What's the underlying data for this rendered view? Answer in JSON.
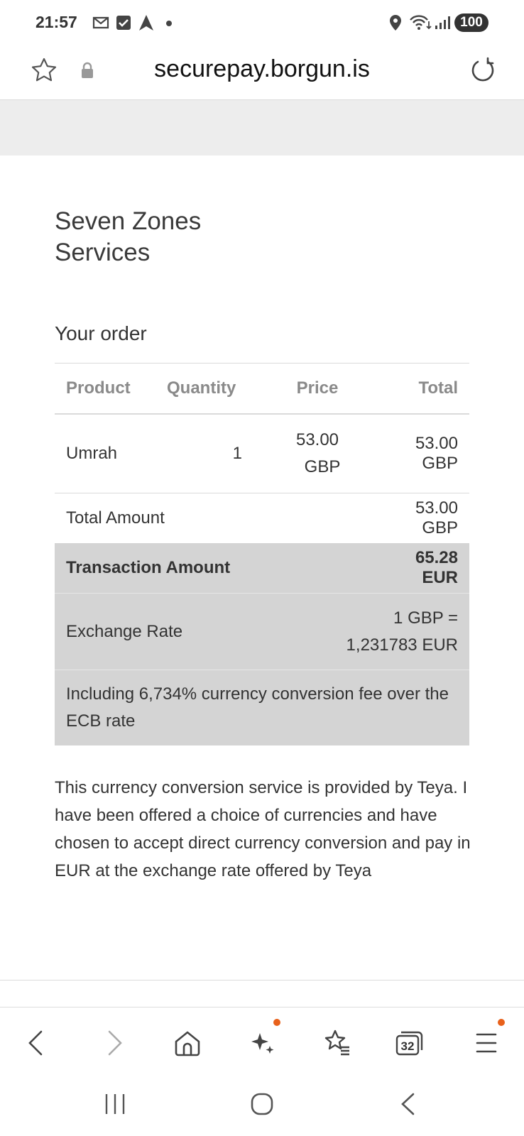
{
  "status": {
    "time": "21:57",
    "battery": "100"
  },
  "browser": {
    "url": "securepay.borgun.is",
    "tab_count": "32"
  },
  "merchant": {
    "name": "Seven Zones Services"
  },
  "order": {
    "title": "Your order",
    "headers": {
      "product": "Product",
      "quantity": "Quantity",
      "price": "Price",
      "total": "Total"
    },
    "item": {
      "product": "Umrah",
      "quantity": "1",
      "price_amount": "53.00",
      "price_currency": "GBP",
      "total": "53.00 GBP"
    },
    "total_amount": {
      "label": "Total Amount",
      "value": "53.00 GBP"
    },
    "transaction_amount": {
      "label": "Transaction Amount",
      "value": "65.28 EUR"
    },
    "exchange_rate": {
      "label": "Exchange Rate",
      "line1": "1 GBP =",
      "line2": "1,231783 EUR"
    },
    "fee_note": "Including 6,734% currency conversion fee over the ECB rate"
  },
  "disclaimer": "This currency conversion service is provided by Teya. I have been offered a choice of currencies and have chosen to accept direct currency conversion and pay in EUR at the exchange rate offered by Teya",
  "colors": {
    "accent_dot": "#e8611b",
    "highlight_bg": "#d4d4d4"
  }
}
